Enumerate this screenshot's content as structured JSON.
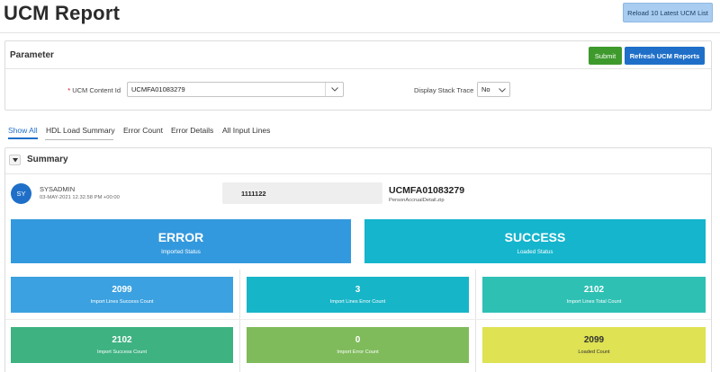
{
  "header": {
    "title": "UCM Report",
    "reload_label": "Reload 10 Latest UCM List"
  },
  "parameter": {
    "title": "Parameter",
    "submit_label": "Submit",
    "refresh_label": "Refresh UCM Reports",
    "ucm_label": "UCM Content Id",
    "ucm_value": "UCMFA01083279",
    "stack_label": "Display Stack Trace",
    "stack_value": "No"
  },
  "tabs": [
    {
      "label": "Show All",
      "active": true
    },
    {
      "label": "HDL Load Summary",
      "active": false
    },
    {
      "label": "Error Count",
      "active": false
    },
    {
      "label": "Error Details",
      "active": false
    },
    {
      "label": "All Input Lines",
      "active": false
    }
  ],
  "summary": {
    "title": "Summary",
    "avatar_initials": "SY",
    "user": "SYSADMIN",
    "date": "03-MAY-2021 12.32.58 PM +00:00",
    "code": "1111122",
    "content_id": "UCMFA01083279",
    "file": "PersonAccrualDetail.zip",
    "imported": {
      "value": "ERROR",
      "label": "Imported Status",
      "color": "#3399de"
    },
    "loaded": {
      "value": "SUCCESS",
      "label": "Loaded Status",
      "color": "#14b5cd"
    },
    "tiles": [
      {
        "value": "2099",
        "label": "Import Lines Success Count",
        "color": "#3ba1e0"
      },
      {
        "value": "3",
        "label": "Import Lines Error Count",
        "color": "#17b5c8"
      },
      {
        "value": "2102",
        "label": "Import Lines Total Count",
        "color": "#2fc0b4"
      },
      {
        "value": "2102",
        "label": "Import Success Count",
        "color": "#3eb281"
      },
      {
        "value": "0",
        "label": "Import Error Count",
        "color": "#7fbb5b"
      },
      {
        "value": "2099",
        "label": "Loaded Count",
        "color": "#dee253"
      }
    ]
  }
}
